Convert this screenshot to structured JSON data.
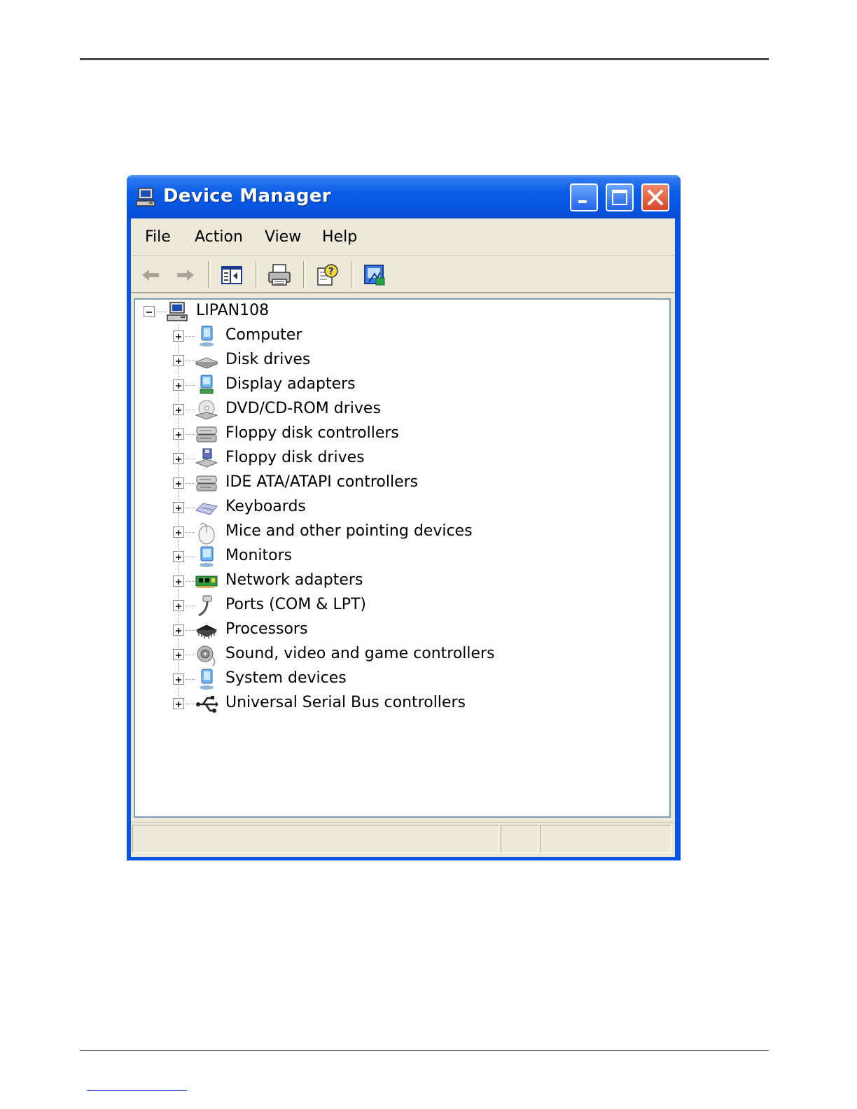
{
  "window": {
    "title": "Device Manager"
  },
  "menu": [
    "File",
    "Action",
    "View",
    "Help"
  ],
  "toolbar": {
    "buttons": [
      "back-icon",
      "forward-icon",
      "show-hide-tree-icon",
      "print-icon",
      "help-icon",
      "update-driver-icon"
    ]
  },
  "tree": {
    "root": {
      "label": "LIPAN108",
      "icon": "computer-icon",
      "expanded": true
    },
    "items": [
      {
        "label": "Computer",
        "icon": "computer-icon"
      },
      {
        "label": "Disk drives",
        "icon": "disk-drive-icon"
      },
      {
        "label": "Display adapters",
        "icon": "display-adapter-icon"
      },
      {
        "label": "DVD/CD-ROM drives",
        "icon": "cdrom-icon"
      },
      {
        "label": "Floppy disk controllers",
        "icon": "controller-icon"
      },
      {
        "label": "Floppy disk drives",
        "icon": "floppy-drive-icon"
      },
      {
        "label": "IDE ATA/ATAPI controllers",
        "icon": "controller-icon"
      },
      {
        "label": "Keyboards",
        "icon": "keyboard-icon"
      },
      {
        "label": "Mice and other pointing devices",
        "icon": "mouse-icon"
      },
      {
        "label": "Monitors",
        "icon": "monitor-icon"
      },
      {
        "label": "Network adapters",
        "icon": "network-adapter-icon"
      },
      {
        "label": "Ports (COM & LPT)",
        "icon": "port-icon"
      },
      {
        "label": "Processors",
        "icon": "processor-icon"
      },
      {
        "label": "Sound, video and game controllers",
        "icon": "sound-icon"
      },
      {
        "label": "System devices",
        "icon": "system-device-icon"
      },
      {
        "label": "Universal Serial Bus controllers",
        "icon": "usb-icon"
      }
    ]
  },
  "colors": {
    "titlebar": "#0a5ee8",
    "chrome": "#ece9d8",
    "close": "#d8462a"
  }
}
